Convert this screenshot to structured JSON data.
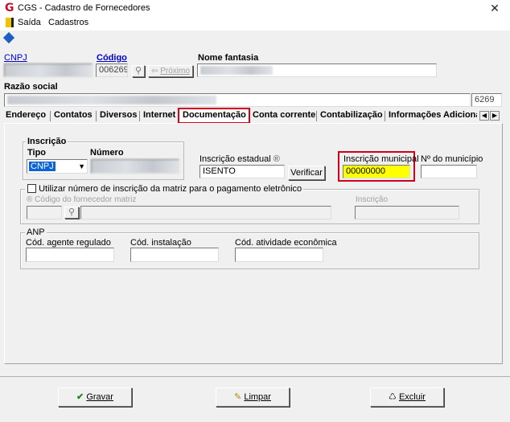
{
  "window": {
    "title": "CGS - Cadastro de Fornecedores",
    "close_glyph": "✕"
  },
  "menu": {
    "exit_label": "Saída",
    "register_label": "Cadastros"
  },
  "header": {
    "cnpj_label": "CNPJ",
    "code_label": "Código",
    "code_value": "006269",
    "next_label": "Próximo",
    "trade_name_label": "Nome fantasia",
    "corporate_name_label": "Razão social",
    "corporate_code_value": "6269"
  },
  "tabs": [
    {
      "label": "Endereço"
    },
    {
      "label": "Contatos"
    },
    {
      "label": "Diversos"
    },
    {
      "label": "Internet"
    },
    {
      "label": "Documentação",
      "active": true
    },
    {
      "label": "Conta corrente"
    },
    {
      "label": "Contabilização"
    },
    {
      "label": "Informações Adiciona"
    }
  ],
  "documentacao": {
    "inscricao_group_title": "Inscrição",
    "tipo_label": "Tipo",
    "tipo_value": "CNPJ",
    "numero_label": "Número",
    "inscricao_estadual_label": "Inscrição estadual",
    "inscricao_estadual_value": "ISENTO",
    "verificar_label": "Verificar",
    "inscricao_municipal_label": "Inscrição municipal",
    "inscricao_municipal_value": "00000000",
    "nro_municipio_label": "Nº do município",
    "matriz_checkbox_label": "Utilizar número de inscrição da matriz para o pagamento eletrônico",
    "codigo_matriz_label": "Código do fornecedor matriz",
    "inscricao_label": "Inscrição",
    "anp_group_title": "ANP",
    "agente_label": "Cód. agente regulado",
    "instalacao_label": "Cód. instalação",
    "atividade_label": "Cód. atividade econômica"
  },
  "footer": {
    "save_label": "Gravar",
    "clear_label": "Limpar",
    "delete_label": "Excluir"
  },
  "colors": {
    "highlight": "#d0021b",
    "link": "#0000cc",
    "field_highlight": "#ffff00"
  }
}
